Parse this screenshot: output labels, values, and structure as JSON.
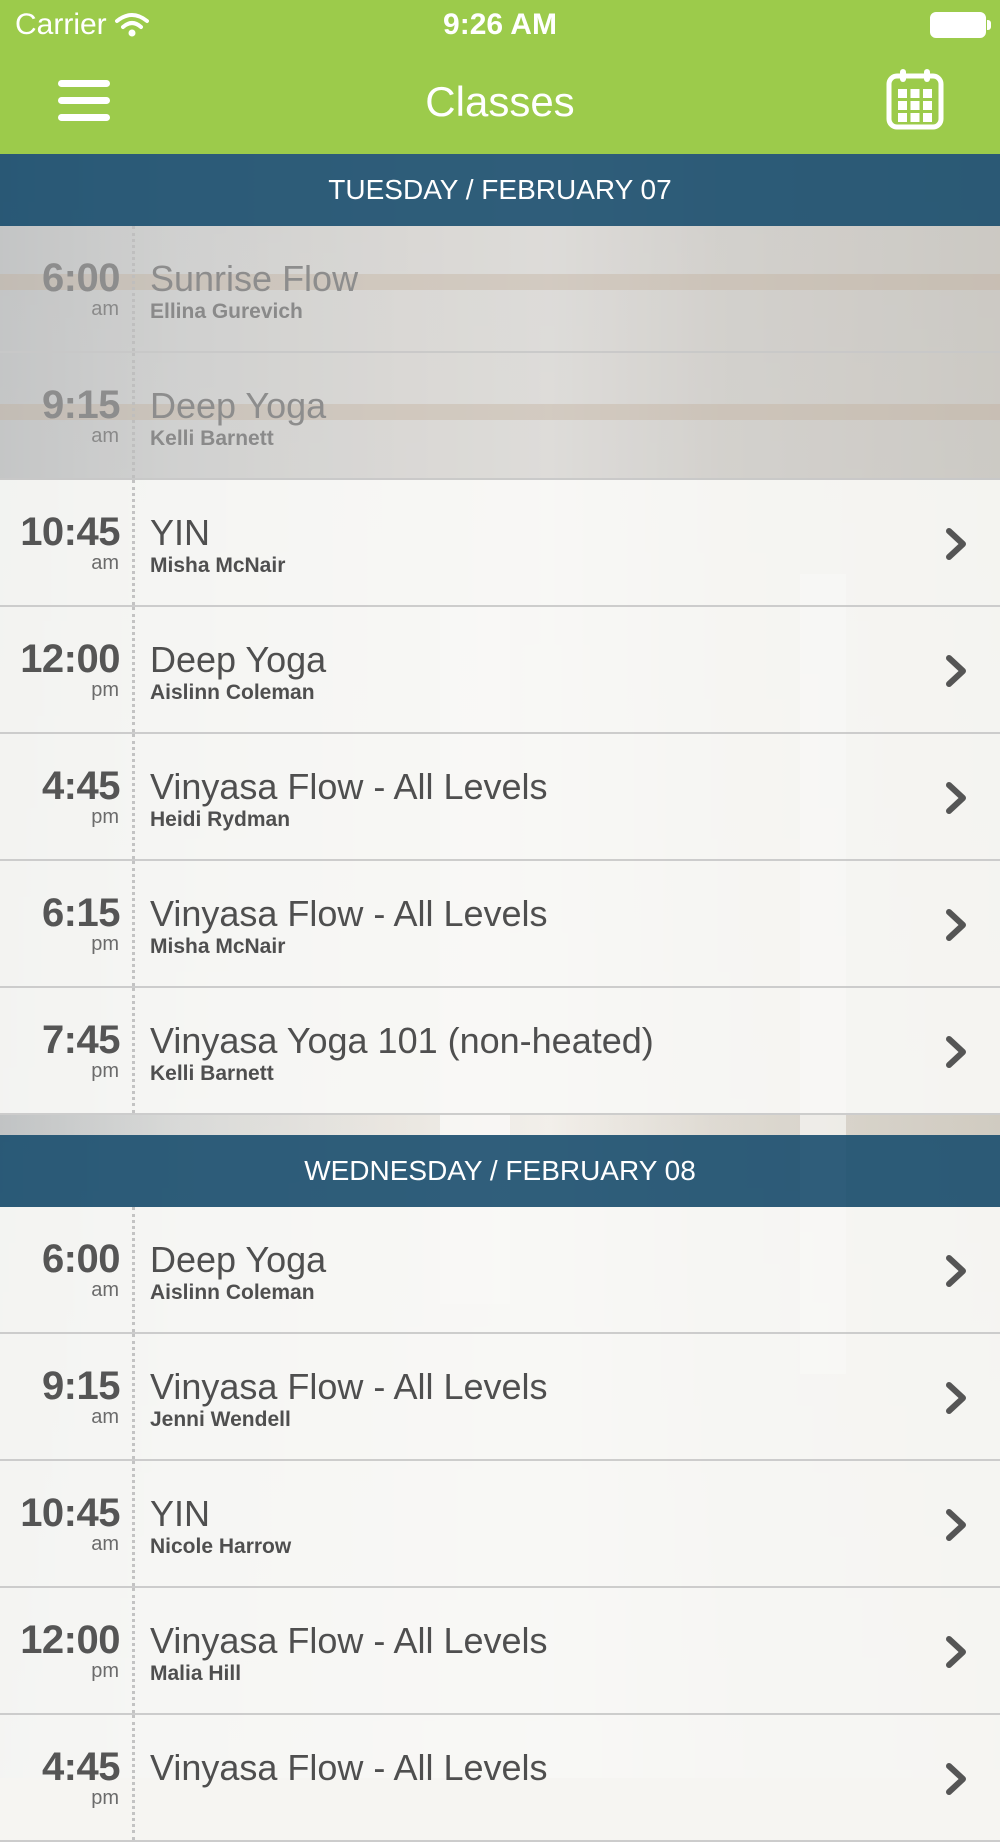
{
  "status_bar": {
    "carrier": "Carrier",
    "time": "9:26 AM"
  },
  "nav": {
    "title": "Classes"
  },
  "days": [
    {
      "header": "TUESDAY / FEBRUARY 07",
      "classes": [
        {
          "time": "6:00",
          "ampm": "am",
          "name": "Sunrise Flow",
          "teacher": "Ellina Gurevich",
          "past": true
        },
        {
          "time": "9:15",
          "ampm": "am",
          "name": "Deep Yoga",
          "teacher": "Kelli Barnett",
          "past": true
        },
        {
          "time": "10:45",
          "ampm": "am",
          "name": "YIN",
          "teacher": "Misha McNair",
          "past": false
        },
        {
          "time": "12:00",
          "ampm": "pm",
          "name": "Deep Yoga",
          "teacher": "Aislinn Coleman",
          "past": false
        },
        {
          "time": "4:45",
          "ampm": "pm",
          "name": "Vinyasa Flow - All Levels",
          "teacher": "Heidi Rydman",
          "past": false
        },
        {
          "time": "6:15",
          "ampm": "pm",
          "name": "Vinyasa Flow - All Levels",
          "teacher": "Misha McNair",
          "past": false
        },
        {
          "time": "7:45",
          "ampm": "pm",
          "name": "Vinyasa Yoga 101 (non-heated)",
          "teacher": "Kelli Barnett",
          "past": false
        }
      ]
    },
    {
      "header": "WEDNESDAY / FEBRUARY 08",
      "classes": [
        {
          "time": "6:00",
          "ampm": "am",
          "name": "Deep Yoga",
          "teacher": "Aislinn Coleman",
          "past": false
        },
        {
          "time": "9:15",
          "ampm": "am",
          "name": "Vinyasa Flow - All Levels",
          "teacher": "Jenni Wendell",
          "past": false
        },
        {
          "time": "10:45",
          "ampm": "am",
          "name": "YIN",
          "teacher": "Nicole Harrow",
          "past": false
        },
        {
          "time": "12:00",
          "ampm": "pm",
          "name": "Vinyasa Flow - All Levels",
          "teacher": "Malia Hill",
          "past": false
        },
        {
          "time": "4:45",
          "ampm": "pm",
          "name": "Vinyasa Flow - All Levels",
          "teacher": "",
          "past": false
        }
      ]
    }
  ],
  "icons": {
    "menu": "hamburger-menu-icon",
    "calendar": "calendar-icon",
    "chevron": "chevron-right-icon"
  },
  "colors": {
    "nav_green": "#9ccb4b",
    "day_header_blue": "#194e6e"
  }
}
